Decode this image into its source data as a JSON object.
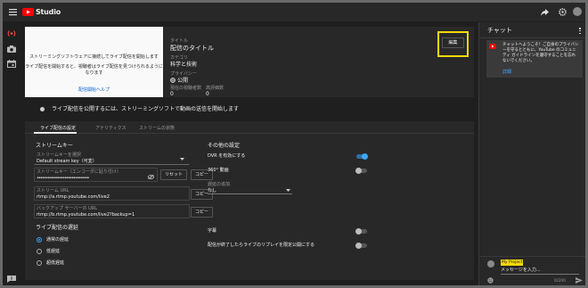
{
  "app": {
    "logo_text": "Studio"
  },
  "preview": {
    "line1": "ストリーミングソフトウェアに接続してライブ配信を開始します",
    "line2": "ライブ配信を開始すると、視聴者はライブ配信を見つけられるように",
    "line3": "なります",
    "help_link": "配信開始ヘルプ"
  },
  "info": {
    "title_label": "タイトル",
    "title_value": "配信のタイトル",
    "category_label": "カテゴリ",
    "category_value": "科学と技術",
    "privacy_label": "プライバシー",
    "privacy_value": "公開",
    "viewers_label": "現在の視聴者数",
    "viewers_value": "0",
    "likes_label": "高評価数",
    "likes_value": "0",
    "edit_button": "編集"
  },
  "banner": {
    "text": "ライブ配信を公開するには、ストリーミングソフトで動画の送信を開始します"
  },
  "tabs": [
    {
      "label": "ライブ配信の設定"
    },
    {
      "label": "アナリティクス"
    },
    {
      "label": "ストリームの状態"
    }
  ],
  "stream_key": {
    "section_title": "ストリームキー",
    "select_label": "ストリームキーを選択",
    "select_value": "Default stream key（可変）",
    "key_label": "ストリームキー（エンコーダに貼り付け）",
    "key_value": "••••••••••••••••••••••••••••••",
    "reset_button": "リセット",
    "copy_button": "コピー",
    "url_label": "ストリーム URL",
    "url_value": "rtmp://a.rtmp.youtube.com/live2",
    "backup_label": "バックアップ サーバーの URL",
    "backup_value": "rtmp://b.rtmp.youtube.com/live2?backup=1"
  },
  "latency": {
    "title": "ライブ配信の遅延",
    "options": [
      {
        "label": "通常の遅延",
        "selected": true
      },
      {
        "label": "低遅延",
        "selected": false
      },
      {
        "label": "超低遅延",
        "selected": false
      }
    ]
  },
  "other_settings": {
    "title": "その他の設定",
    "dvr_label": "DVR を有効にする",
    "dvr_on": true,
    "v360_label": "360° 動画",
    "v360_on": false,
    "delay_label": "遅延の追加",
    "delay_value": "なし",
    "captions_label": "字幕",
    "captions_on": false,
    "unlisted_label": "配信が終了したらライブのリプレイを限定公開にする",
    "unlisted_on": false
  },
  "chat": {
    "title": "チャット",
    "welcome_text": "チャットへようこそ！ご自身のプライバシーを守るとともに、YouTube のコミュニティ ガイドラインを遵守することを忘れないでください。",
    "details_link": "詳細",
    "user_badge": "My Project",
    "input_placeholder": "メッセージを入力...",
    "char_count": "0/200"
  },
  "colors": {
    "accent": "#3ea6ff",
    "brand": "#ff0000",
    "highlight": "#f5d90a"
  }
}
